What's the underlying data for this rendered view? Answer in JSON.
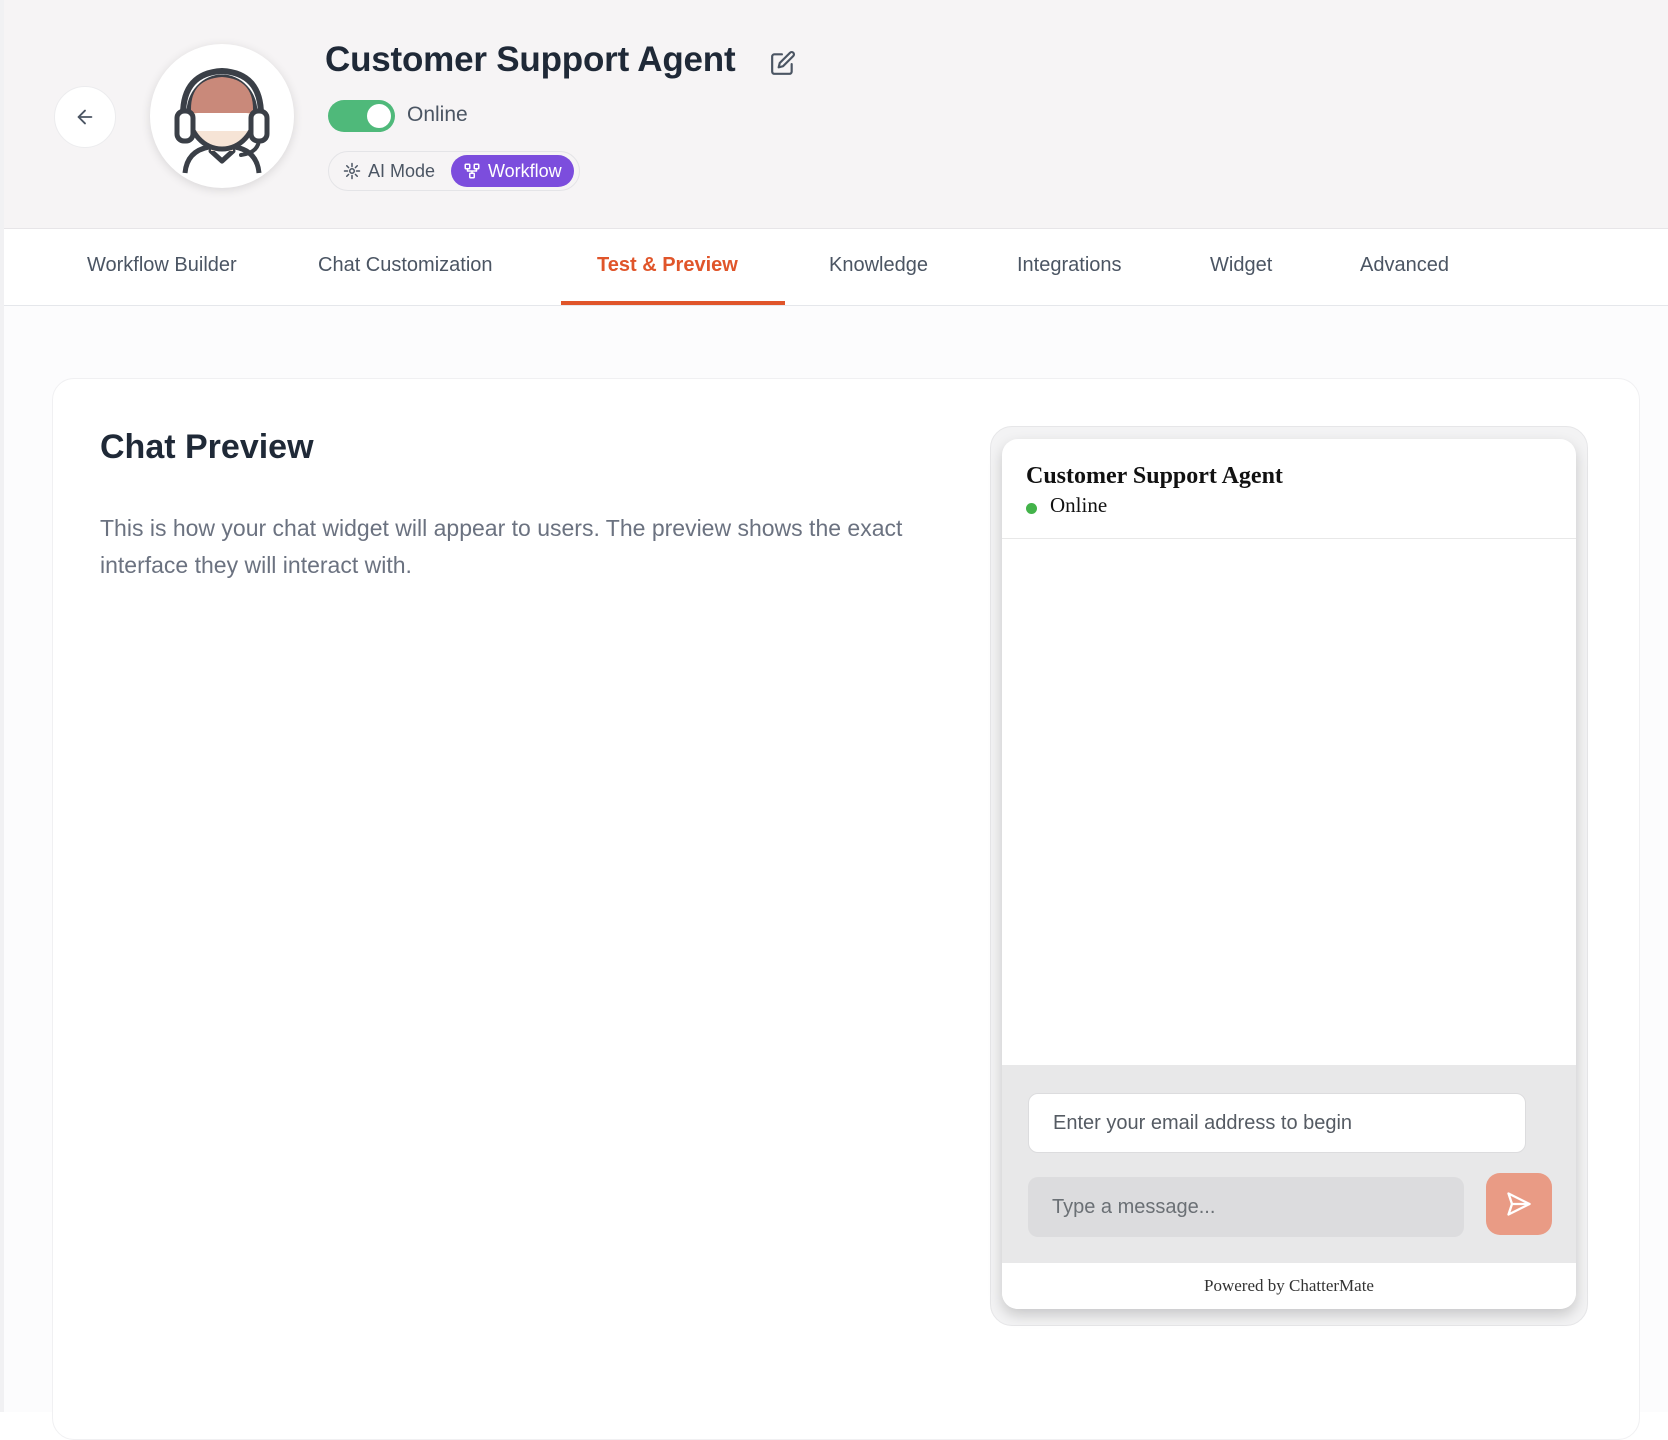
{
  "header": {
    "agent_name": "Customer Support Agent",
    "status_label": "Online",
    "status_enabled": true,
    "modes": {
      "ai_label": "AI Mode",
      "workflow_label": "Workflow",
      "active": "Workflow"
    }
  },
  "tabs": [
    {
      "label": "Workflow Builder"
    },
    {
      "label": "Chat Customization"
    },
    {
      "label": "Test & Preview",
      "active": true
    },
    {
      "label": "Knowledge"
    },
    {
      "label": "Integrations"
    },
    {
      "label": "Widget"
    },
    {
      "label": "Advanced"
    }
  ],
  "preview": {
    "title": "Chat Preview",
    "description": "This is how your chat widget will appear to users. The preview shows the exact interface they will interact with."
  },
  "widget": {
    "agent_name": "Customer Support Agent",
    "status": "Online",
    "email_placeholder": "Enter your email address to begin",
    "message_placeholder": "Type a message...",
    "footer": "Powered by ChatterMate"
  },
  "icons": {
    "back": "arrow-left-icon",
    "edit": "edit-pencil-icon",
    "ai_mode": "sparkle-icon",
    "workflow": "workflow-icon",
    "send": "send-icon",
    "avatar": "headset-agent-avatar"
  },
  "colors": {
    "accent": "#e0552a",
    "online_toggle": "#4fb97a",
    "workflow_pill": "#7c4ddd",
    "send_button": "#e99b85",
    "online_dot": "#43b34a"
  }
}
